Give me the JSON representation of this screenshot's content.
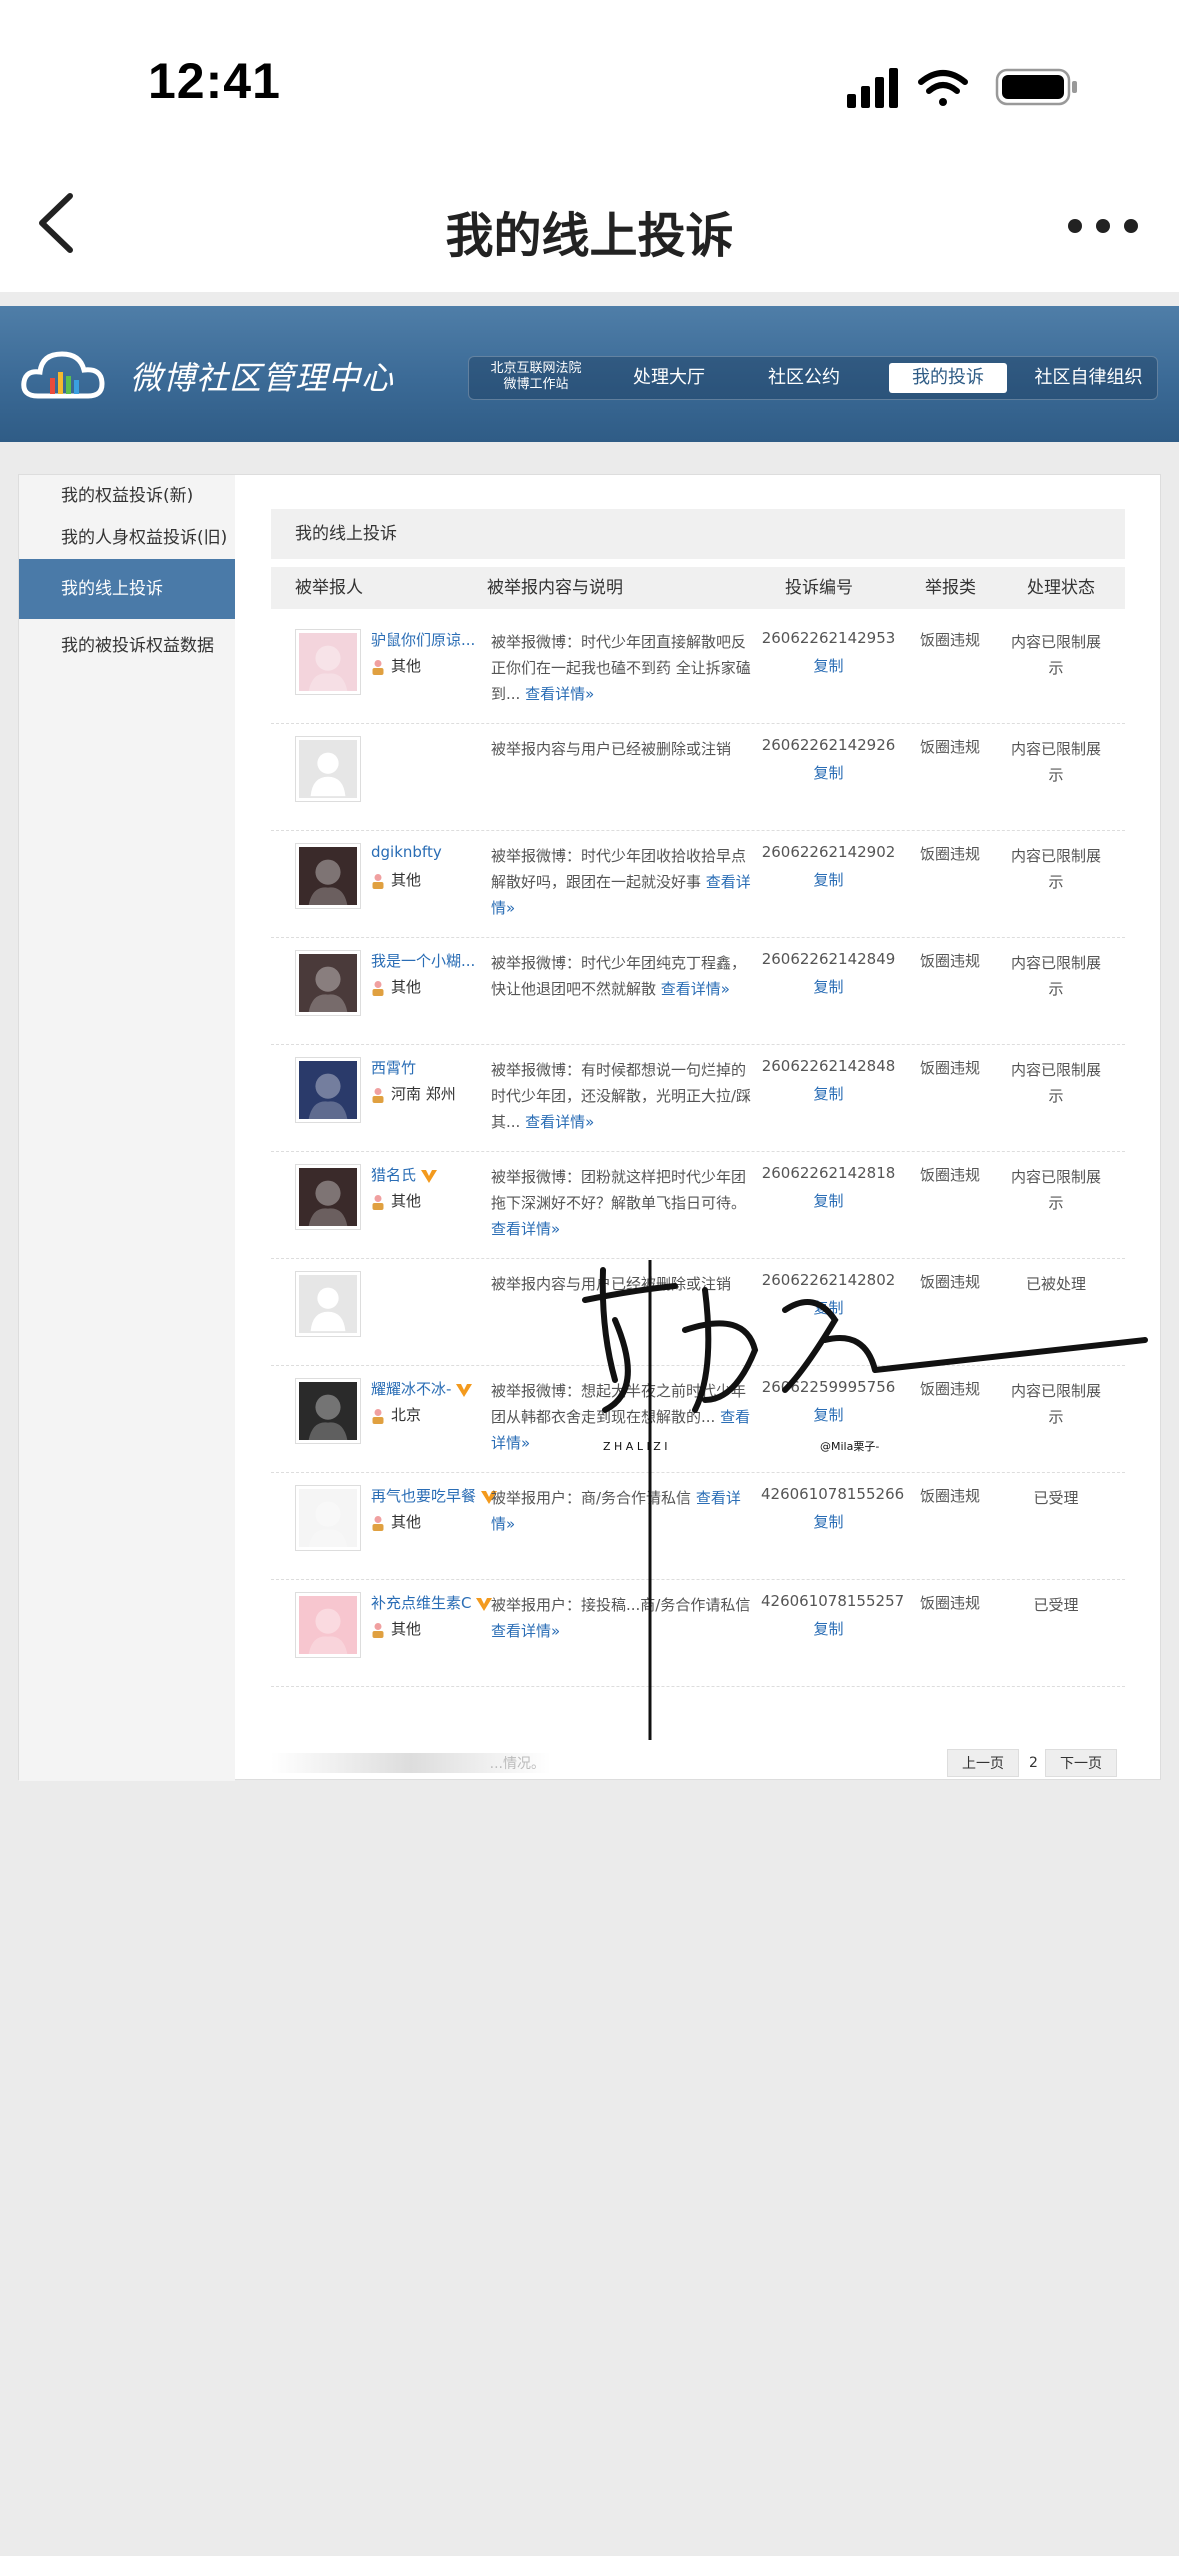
{
  "status_bar": {
    "time": "12:41"
  },
  "nav": {
    "title": "我的线上投诉"
  },
  "header": {
    "title": "微博社区管理中心",
    "court_line1": "北京互联网法院",
    "court_line2": "微博工作站",
    "tabs": [
      "处理大厅",
      "社区公约",
      "我的投诉",
      "社区自律组织"
    ],
    "active_tab": "我的投诉"
  },
  "sidebar": {
    "items": [
      "我的权益投诉(新)",
      "我的人身权益投诉(旧)",
      "我的线上投诉",
      "我的被投诉权益数据"
    ],
    "active": "我的线上投诉"
  },
  "table": {
    "title": "我的线上投诉",
    "columns": [
      "被举报人",
      "被举报内容与说明",
      "投诉编号",
      "举报类",
      "处理状态"
    ],
    "copy_label": "复制",
    "rows": [
      {
        "name": "驴鼠你们原谅...",
        "loc": "其他",
        "desc": "被举报微博：时代少年团直接解散吧反正你们在一起我也磕不到药 全让拆家磕到...",
        "more": "查看详情»",
        "id": "26062262142953",
        "type": "饭圈违规",
        "status": "内容已限制展示",
        "verified": false
      },
      {
        "name": "",
        "loc": "",
        "desc": "被举报内容与用户已经被删除或注销",
        "more": "",
        "id": "26062262142926",
        "type": "饭圈违规",
        "status": "内容已限制展示",
        "verified": false
      },
      {
        "name": "dgiknbfty",
        "loc": "其他",
        "desc": "被举报微博：时代少年团收拾收拾早点解散好吗，跟团在一起就没好事",
        "more": "查看详情»",
        "id": "26062262142902",
        "type": "饭圈违规",
        "status": "内容已限制展示",
        "verified": false
      },
      {
        "name": "我是一个小糊...",
        "loc": "其他",
        "desc": "被举报微博：时代少年团纯克丁程鑫，快让他退团吧不然就解散",
        "more": "查看详情»",
        "id": "26062262142849",
        "type": "饭圈违规",
        "status": "内容已限制展示",
        "verified": false
      },
      {
        "name": "西霄竹",
        "loc": "河南 郑州",
        "desc": "被举报微博：有时候都想说一句烂掉的时代少年团，还没解散，光明正大拉/踩其...",
        "more": "查看详情»",
        "id": "26062262142848",
        "type": "饭圈违规",
        "status": "内容已限制展示",
        "verified": false
      },
      {
        "name": "猎名氏",
        "loc": "其他",
        "desc": "被举报微博：团粉就这样把时代少年团拖下深渊好不好？解散单飞指日可待。",
        "more": "查看详情»",
        "id": "26062262142818",
        "type": "饭圈违规",
        "status": "内容已限制展示",
        "verified": true
      },
      {
        "name": "",
        "loc": "",
        "desc": "被举报内容与用户已经被删除或注销",
        "more": "",
        "id": "26062262142802",
        "type": "饭圈违规",
        "status": "已被处理",
        "verified": false
      },
      {
        "name": "耀耀冰不冰-",
        "loc": "北京",
        "desc": "被举报微博：想起大半夜之前时代少年团从韩都衣舍走到现在想解散的...",
        "more": "查看详情»",
        "id": "26062259995756",
        "type": "饭圈违规",
        "status": "内容已限制展示",
        "verified": true
      },
      {
        "name": "再气也要吃早餐",
        "loc": "其他",
        "desc": "被举报用户：商/务合作请私信",
        "more": "查看详情»",
        "id": "426061078155266",
        "type": "饭圈违规",
        "status": "已受理",
        "verified": true
      },
      {
        "name": "补充点维生素C",
        "loc": "其他",
        "desc": "被举报用户：接投稿...商/务合作请私信",
        "more": "查看详情»",
        "id": "426061078155257",
        "type": "饭圈违规",
        "status": "已受理",
        "verified": true
      }
    ]
  },
  "pager": {
    "footnote": "...情况。",
    "prev": "上一页",
    "page": "2",
    "next": "下一页"
  },
  "watermark": {
    "letters": "Z H A L I Z I",
    "handle": "@Mila栗子-"
  },
  "colors": {
    "header_blue": "#3b6a96",
    "link_blue": "#2a6db5",
    "active_side": "#4a7aa8",
    "verified_orange": "#f39a1e"
  }
}
